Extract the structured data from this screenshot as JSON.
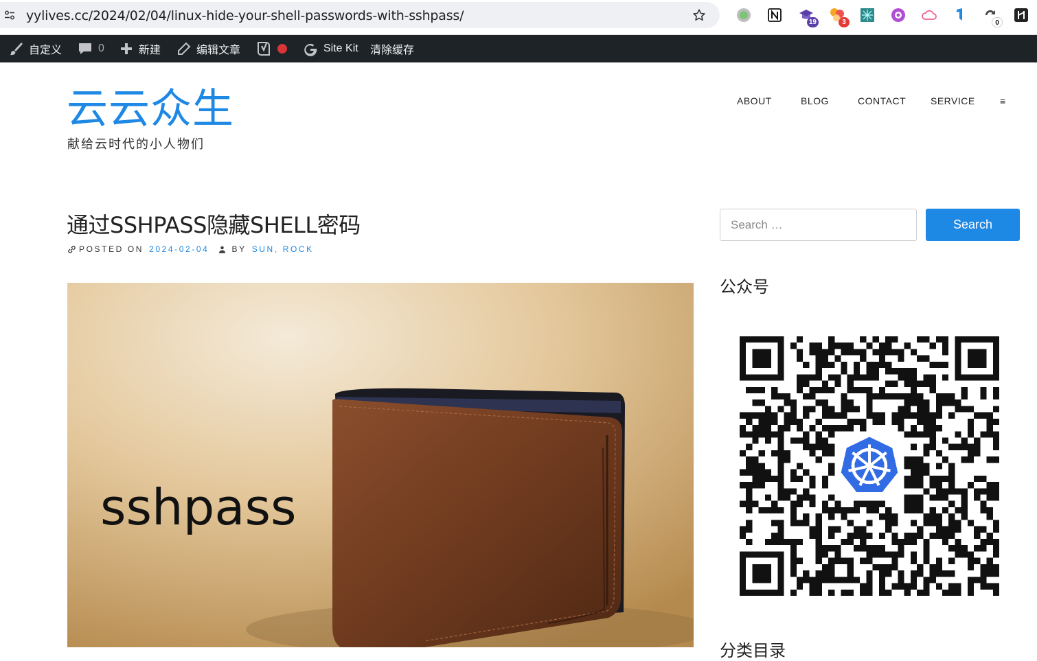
{
  "browser": {
    "url": "yylives.cc/2024/02/04/linux-hide-your-shell-passwords-with-sshpass/",
    "extensions": [
      {
        "name": "green-circle-extension-icon",
        "badge": ""
      },
      {
        "name": "notion-extension-icon",
        "badge": ""
      },
      {
        "name": "graduation-extension-icon",
        "badge": "19"
      },
      {
        "name": "cluster-extension-icon",
        "badge": "3"
      },
      {
        "name": "network-extension-icon",
        "badge": ""
      },
      {
        "name": "purple-extension-icon",
        "badge": ""
      },
      {
        "name": "cloud-extension-icon",
        "badge": ""
      },
      {
        "name": "blue-ribbon-extension-icon",
        "badge": ""
      },
      {
        "name": "refresh-counter-extension-icon",
        "badge": "0"
      },
      {
        "name": "dark-square-extension-icon",
        "badge": ""
      }
    ]
  },
  "admin_bar": {
    "customize": "自定义",
    "comments_count": "0",
    "new": "新建",
    "edit_post": "编辑文章",
    "site_kit": "Site Kit",
    "clear_cache": "清除缓存"
  },
  "site": {
    "title": "云云众生",
    "description": "献给云时代的小人物们"
  },
  "nav": {
    "items": [
      "ABOUT",
      "BLOG",
      "CONTACT",
      "SERVICE"
    ],
    "menu_symbol": "≡"
  },
  "post": {
    "title": "通过SSHPASS隐藏SHELL密码",
    "posted_on_label": "POSTED ON",
    "date": "2024-02-04",
    "by_label": "BY",
    "authors": "SUN, ROCK",
    "image_text": "sshpass"
  },
  "sidebar": {
    "search_placeholder": "Search …",
    "search_button": "Search",
    "widget_wechat_title": "公众号",
    "widget_categories_title": "分类目录"
  },
  "colors": {
    "accent": "#1e88e5",
    "admin_bar": "#1d2327"
  }
}
